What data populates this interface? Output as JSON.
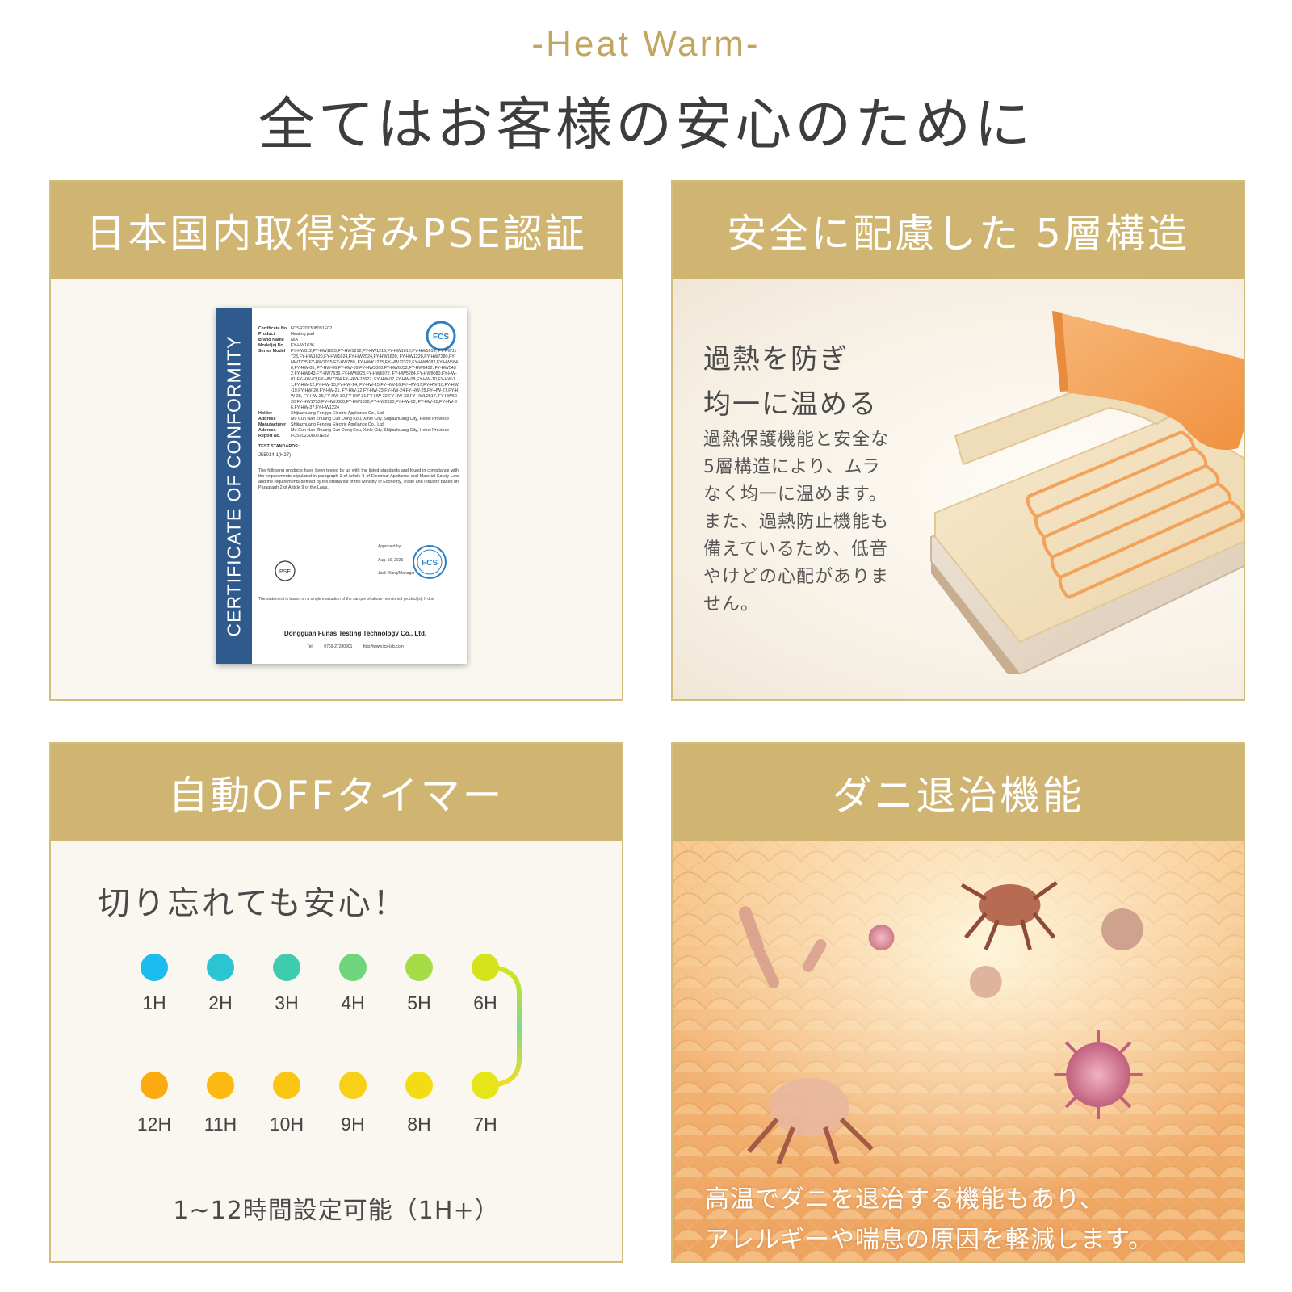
{
  "header": {
    "tagline": "-Heat Warm-",
    "title": "全てはお客様の安心のために"
  },
  "cards": {
    "pse": {
      "title": "日本国内取得済みPSE認証",
      "certificate": {
        "side_band": "CERTIFICATE OF CONFORMITY",
        "rows": [
          {
            "k": "Certificate No.",
            "v": "FCSR202308091E02"
          },
          {
            "k": "Product",
            "v": "Heating pad"
          },
          {
            "k": "Brand Name",
            "v": "N/A"
          },
          {
            "k": "Model(s) No.",
            "v": "FY-HW1636"
          }
        ],
        "series_label": "Series Model",
        "series_models": "FY-HW812,FY-HW1820,FY-HW1212,FY-HW1216,FY-HW1010,FY-HW1616, FY-HWJ1723,FY-HW1620,FY-HW1624,FY-HW2024,FY-HW1630, FY-HW1228,FY-HW7280,FY-HW1725,FY-HW1025,FY-HWZ80, FY-HWK1225,FY-HWJ2322,FY-HW8082,FY-HW5840,FY-HW-05, FY-HW-06,FY-HW-09,FY-HW5060,FY-HW6032,FY-HW6452, FY-HW5432,FY-HW643,FY-HW7536,FY-HW6028,FY-HW6072, FY-HW5284,FY-HW8080,FY-HW-01,FY-HW-03,FY-HW7284,FY-HWHJ2627, FY-HW-07,FY-HW-08,FY-HW-10,FY-HW-11,FY-HW-12,FY-HW-13,FY-HW-14, FY-HW-15,FY-HW-16,FY-HW-17,FY-HW-18,FY-HW-19,FY-HW-20,FY-HW-21, FY-HW-22,FY-HW-23,FY-HW-24,FY-HW-25,FY-HW-27,FY-HW-28, FY-HW-29,FY-HW-30,FY-HW-31,FY-HW-32,FY-HW-33,FY-HWL2517, FY-HW6020,FY-HW1733,FY-HWJ868,FY-HW1836,FY-HW2550,FY-HW-02, FY-HW-35,FY-HW-36,FY-HW-37,FY-HW1224",
        "rows2": [
          {
            "k": "Holder",
            "v": "Shijiazhuang Fengya Electric Appliance Co., Ltd."
          },
          {
            "k": "Address",
            "v": "Mu Cun Nan Zhuang Cun Dong Kou, Xinle City, Shijiazhuang City, Hebei Province"
          },
          {
            "k": "Manufacturer",
            "v": "Shijiazhuang Fengya Electric Appliance Co., Ltd."
          },
          {
            "k": "Address",
            "v": "Mu Cun Nan Zhuang Cun Dong Kou, Xinle City, Shijiazhuang City, Hebei Province"
          },
          {
            "k": "Report No.",
            "v": "FCS202308091E02"
          }
        ],
        "standards_title": "TEST STANDARDS:",
        "standard": "J55014-1(H27)",
        "paragraph": "The following products have been tested by us with the listed standards and found in compliance with the requirements stipulated in paragraph 1 of Article 8 of Electrical Appliance and Material Safety Law and the requirements defined by the ordinance of the Ministry of Economy, Trade and Industry based on Paragraph 2 of Article 9 of the Laws.",
        "approved": "Approved by:",
        "date": "Aug. 16, 2023",
        "signer": "Jack Wang/Manager",
        "note": "The statement is based on a single evaluation of the sample of above mentioned product(s). It doe",
        "company": "Dongguan Funas Testing Technology Co., Ltd.",
        "contact": "Tel: 0769-27280901 http://www.fcs-lab.com",
        "logo_text": "FCS",
        "pse_mark": "PSE"
      }
    },
    "layers": {
      "title": "安全に配慮した 5層構造",
      "heading_line1": "過熱を防ぎ",
      "heading_line2": "均一に温める",
      "desc": [
        "過熱保護機能と安全な",
        "5層構造により、ムラ",
        "なく均一に温めます。",
        "また、過熱防止機能も",
        "備えているため、低音",
        "やけどの心配がありま",
        "せん。"
      ]
    },
    "timer": {
      "title": "自動OFFタイマー",
      "subtitle": "切り忘れても安心！",
      "row1": [
        "1H",
        "2H",
        "3H",
        "4H",
        "5H",
        "6H"
      ],
      "row2": [
        "12H",
        "11H",
        "10H",
        "9H",
        "8H",
        "7H"
      ],
      "row1_colors": [
        "#1bbcef",
        "#2cc3d3",
        "#3fccae",
        "#6fd57c",
        "#a5dc45",
        "#d6e31c"
      ],
      "row2_colors": [
        "#fbab10",
        "#fbb912",
        "#fbc514",
        "#f9d018",
        "#f3dc14",
        "#e6e51a"
      ],
      "note": "1~12時間設定可能（1H+）"
    },
    "mite": {
      "title": "ダニ退治機能",
      "caption_line1": "高温でダニを退治する機能もあり、",
      "caption_line2": "アレルギーや喘息の原因を軽減します。"
    }
  },
  "colors": {
    "gold": "#cfb571",
    "gold_border": "#d2bd7d",
    "cert_band": "#2f5a8e"
  }
}
